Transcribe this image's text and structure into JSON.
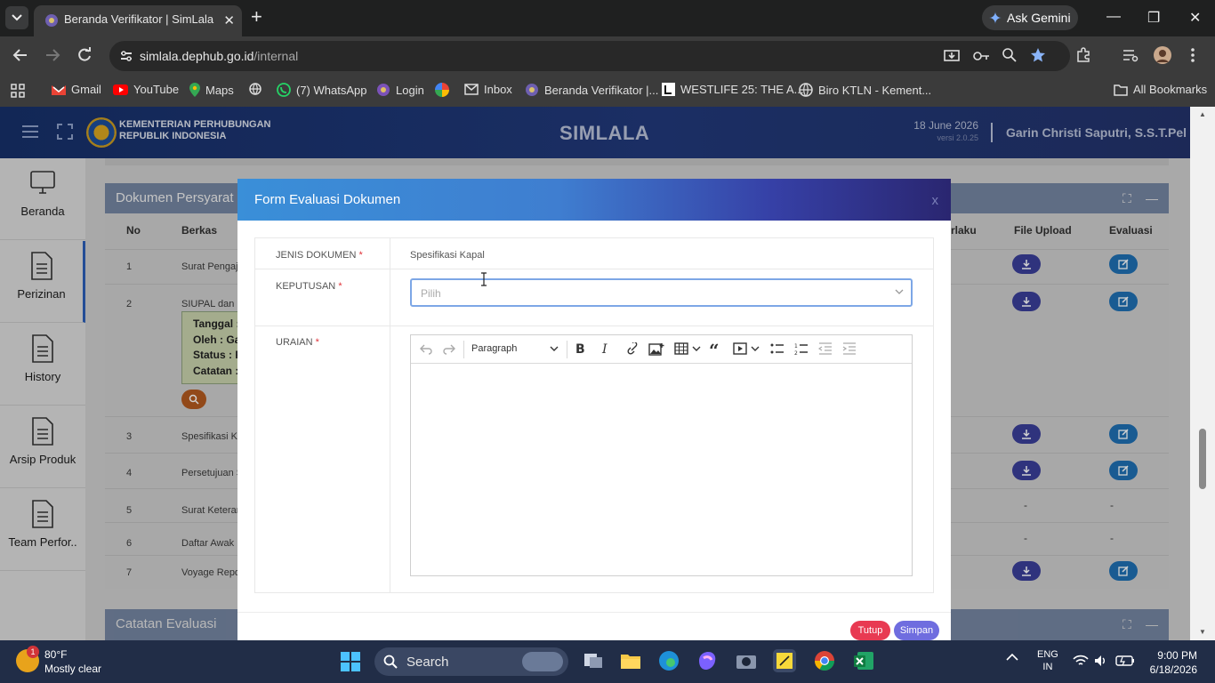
{
  "browser": {
    "tab_title": "Beranda Verifikator | SimLala",
    "url_host": "simlala.dephub.go.id",
    "url_path": "/internal",
    "gemini_label": "Ask Gemini",
    "bookmarks": [
      "Gmail",
      "YouTube",
      "Maps",
      "(7) WhatsApp",
      "Login",
      "Inbox",
      "Beranda Verifikator |...",
      "WESTLIFE 25: THE A...",
      "Biro KTLN - Kement..."
    ],
    "all_bookmarks": "All Bookmarks"
  },
  "header": {
    "org_line1": "KEMENTERIAN PERHUBUNGAN",
    "org_line2": "REPUBLIK INDONESIA",
    "app_title": "SIMLALA",
    "date": "18 June 2026",
    "version": "versi 2.0.25",
    "user": "Garin Christi Saputri, S.S.T.Pel"
  },
  "sidebar": {
    "items": [
      {
        "label": "Beranda",
        "icon": "monitor-icon"
      },
      {
        "label": "Perizinan",
        "icon": "document-icon"
      },
      {
        "label": "History",
        "icon": "document-icon"
      },
      {
        "label": "Arsip Produk",
        "icon": "document-icon"
      },
      {
        "label": "Team Perfor..",
        "icon": "document-icon"
      }
    ]
  },
  "panel": {
    "title": "Dokumen Persyarat",
    "columns": {
      "no": "No",
      "berkas": "Berkas",
      "berlaku": "rlaku",
      "file_upload": "File Upload",
      "evaluasi": "Evaluasi"
    },
    "rows": [
      {
        "no": "1",
        "berkas": "Surat Pengaj"
      },
      {
        "no": "2",
        "berkas": "SIUPAL dan B"
      },
      {
        "no": "3",
        "berkas": "Spesifikasi K"
      },
      {
        "no": "4",
        "berkas": "Persetujuan S"
      },
      {
        "no": "5",
        "berkas": "Surat Keteran"
      },
      {
        "no": "6",
        "berkas": "Daftar Awak"
      },
      {
        "no": "7",
        "berkas": "Voyage Repo"
      }
    ],
    "note": {
      "tanggal": "Tanggal :",
      "oleh": "Oleh : Ga",
      "status": "Status : P",
      "catatan": "Catatan :"
    },
    "dash": "-"
  },
  "panel2": {
    "title": "Catatan Evaluasi"
  },
  "modal": {
    "title": "Form Evaluasi Dokumen",
    "close": "x",
    "jenis_label": "JENIS DOKUMEN",
    "jenis_value": "Spesifikasi Kapal",
    "keputusan_label": "KEPUTUSAN",
    "keputusan_placeholder": "Pilih",
    "uraian_label": "URAIAN",
    "required_mark": "*",
    "paragraph_label": "Paragraph",
    "btn_tutup": "Tutup",
    "btn_simpan": "Simpan"
  },
  "taskbar": {
    "weather_badge": "1",
    "temp": "80°F",
    "weather": "Mostly clear",
    "search": "Search",
    "lang1": "ENG",
    "lang2": "IN",
    "time": "9:00 PM",
    "date": "6/18/2026"
  }
}
